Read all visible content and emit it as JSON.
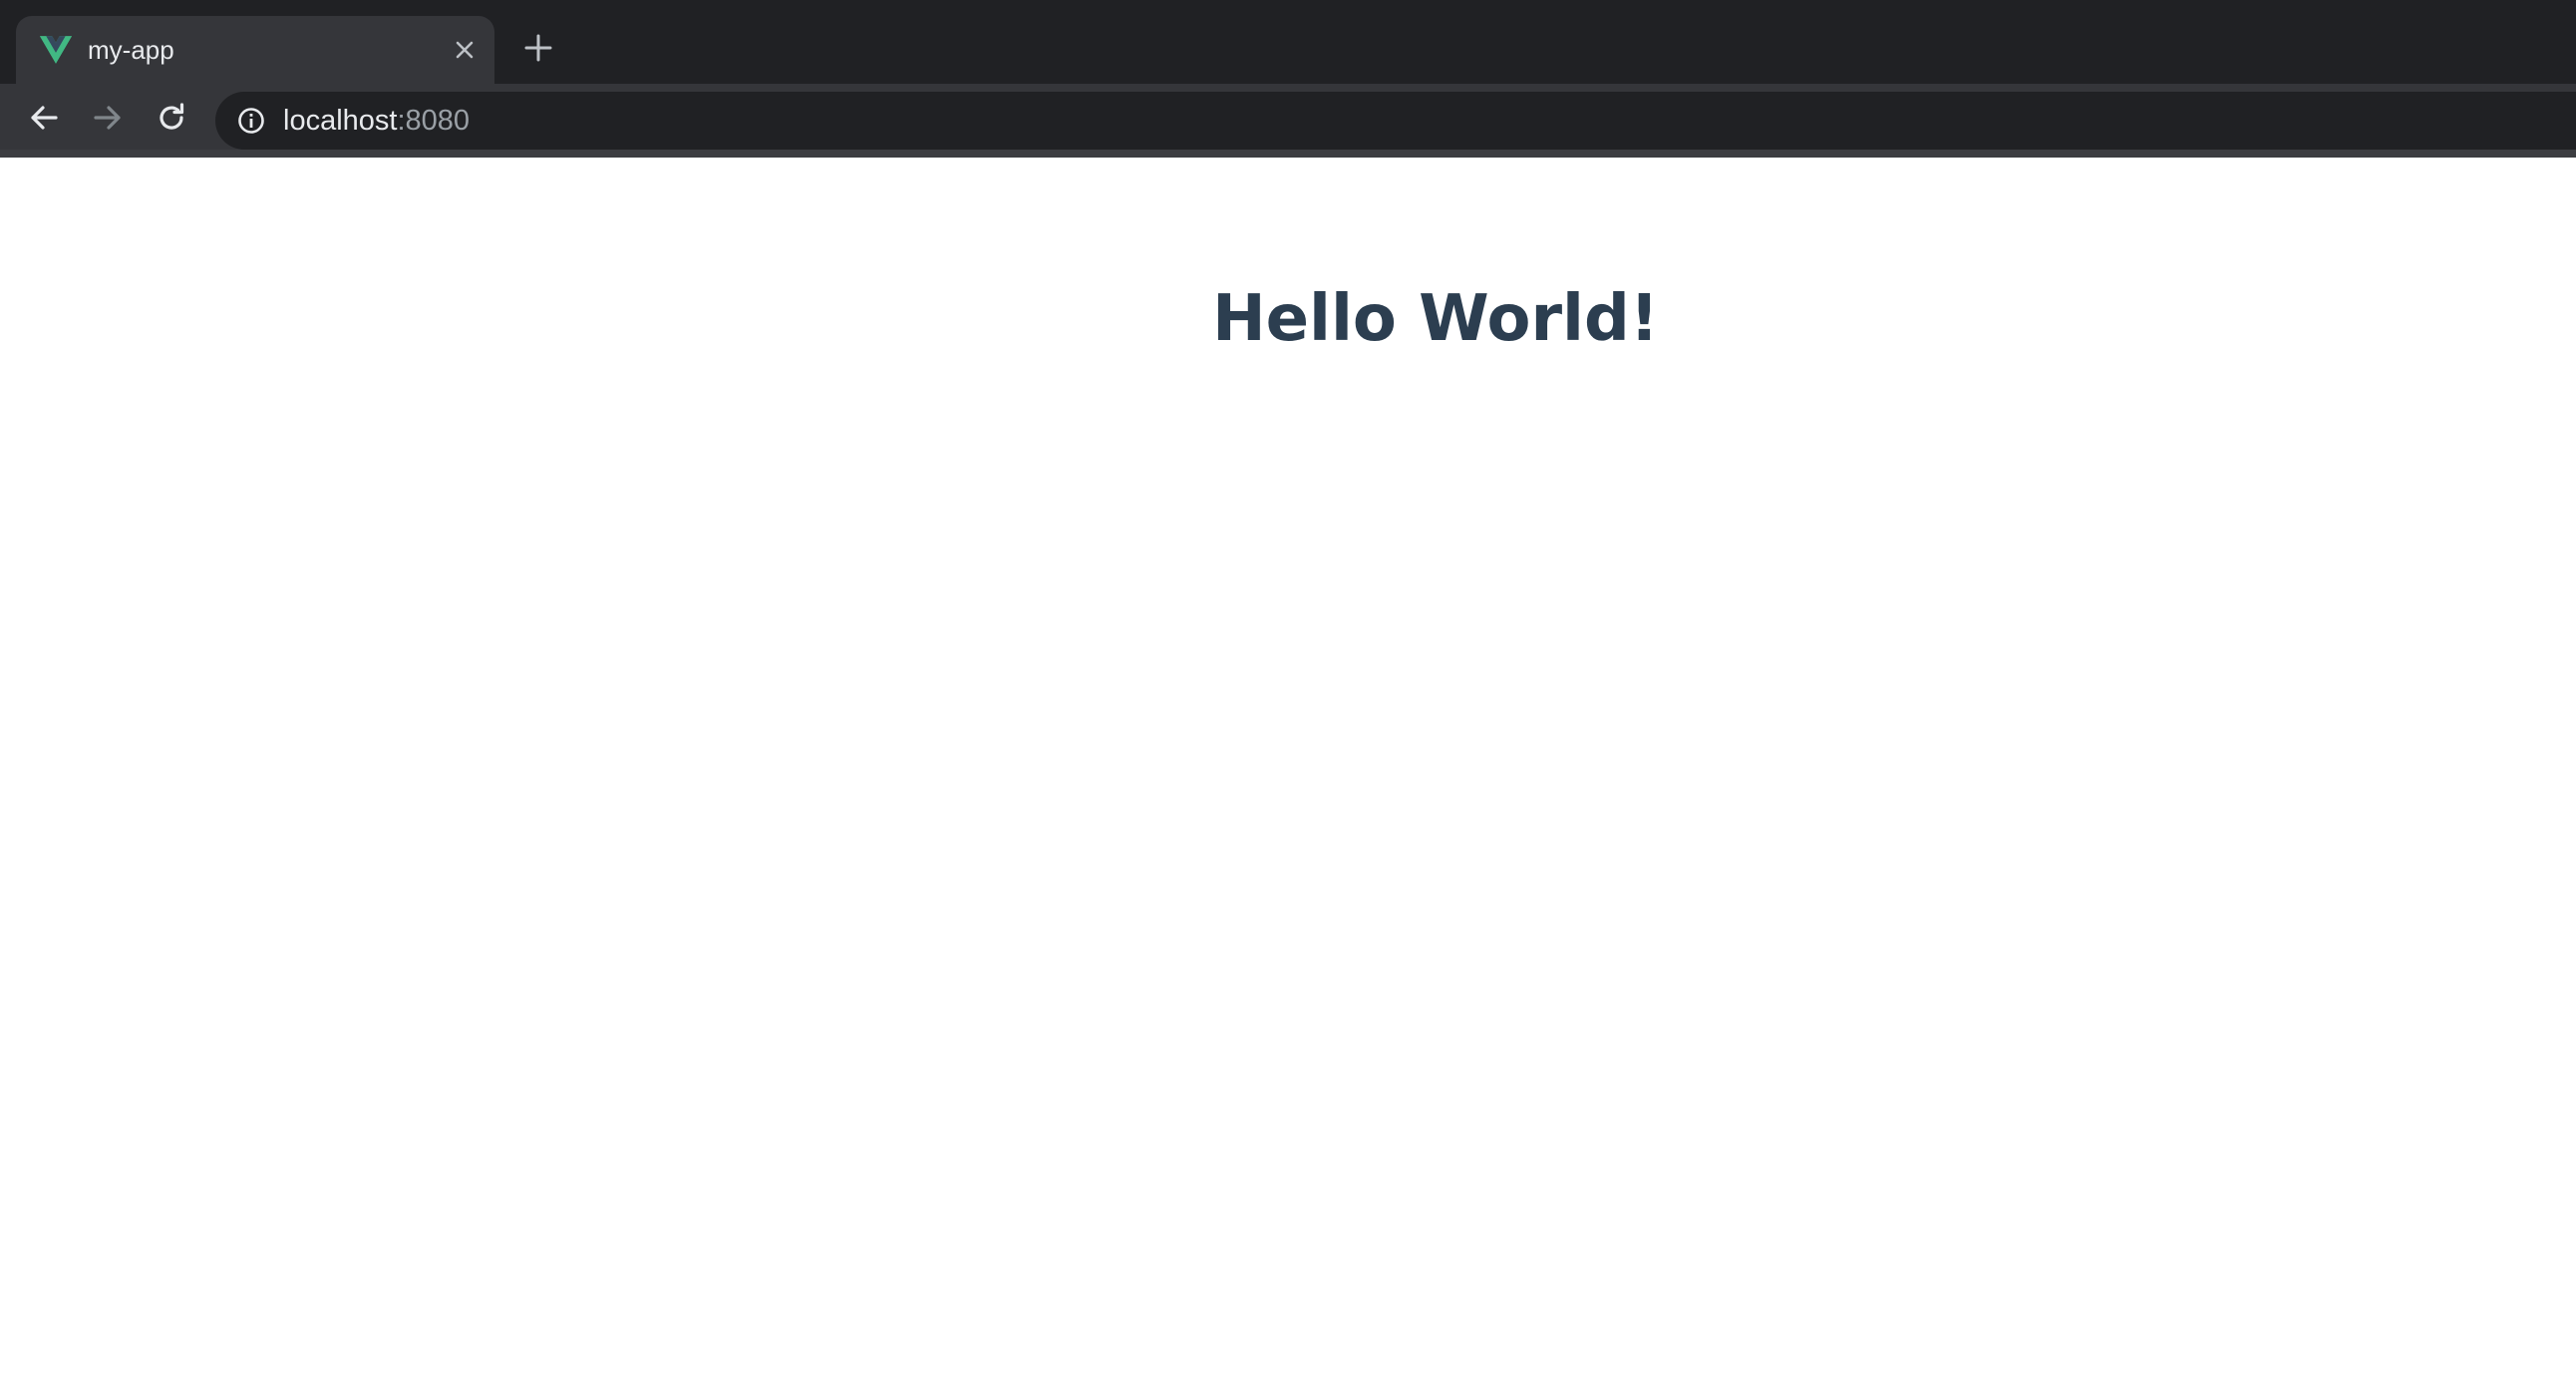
{
  "tab": {
    "title": "my-app",
    "favicon": "vue-logo-icon"
  },
  "address_bar": {
    "host": "localhost",
    "port": ":8080"
  },
  "page": {
    "heading": "Hello World!"
  },
  "colors": {
    "tabstrip_bg": "#202124",
    "toolbar_bg": "#35363a",
    "heading": "#2c3e50",
    "vue_green": "#41b883",
    "vue_dark": "#35495e"
  }
}
